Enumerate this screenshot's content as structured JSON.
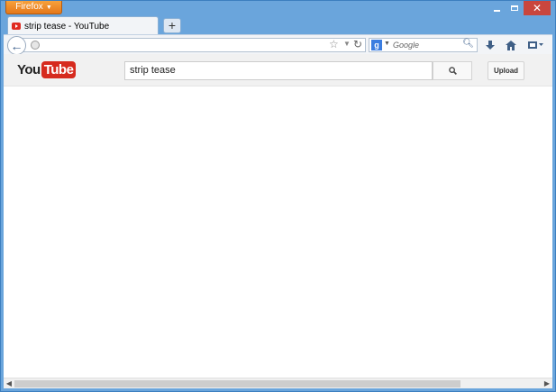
{
  "browser": {
    "menu_button": "Firefox",
    "tab": {
      "title": "strip tease - YouTube",
      "favicon": "youtube-favicon"
    },
    "new_tab": "+",
    "url": "",
    "search_engine_placeholder": "Google",
    "window_controls": {
      "minimize": "minimize-icon",
      "maximize": "maximize-icon",
      "close": "✕"
    }
  },
  "youtube": {
    "logo": {
      "you": "You",
      "tube": "Tube"
    },
    "search_query": "strip tease",
    "upload_label": "Upload"
  },
  "colors": {
    "chrome_blue": "#6aa5dc",
    "firefox_orange": "#e5781a",
    "youtube_red": "#d62a1e",
    "close_red": "#c9463d"
  }
}
